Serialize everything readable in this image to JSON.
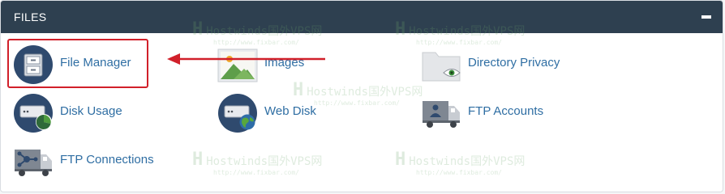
{
  "panel": {
    "title": "FILES",
    "collapse_icon": "minus-icon"
  },
  "items": [
    {
      "label": "File Manager",
      "icon": "file-cabinet-icon"
    },
    {
      "label": "Images",
      "icon": "image-icon"
    },
    {
      "label": "Directory Privacy",
      "icon": "folder-eye-icon"
    },
    {
      "label": "Disk Usage",
      "icon": "disk-usage-icon"
    },
    {
      "label": "Web Disk",
      "icon": "web-disk-icon"
    },
    {
      "label": "FTP Accounts",
      "icon": "ftp-truck-icon"
    },
    {
      "label": "FTP Connections",
      "icon": "ftp-connections-icon"
    }
  ],
  "annotation": {
    "highlight_color": "#d1202a",
    "arrow_color": "#d1202a"
  },
  "watermark": {
    "logo": "H",
    "title": "Hostwinds国外VPS网",
    "url": "http://www.fixbar.com/"
  },
  "colors": {
    "header_bg": "#2e4050",
    "link": "#2f6ea3"
  }
}
